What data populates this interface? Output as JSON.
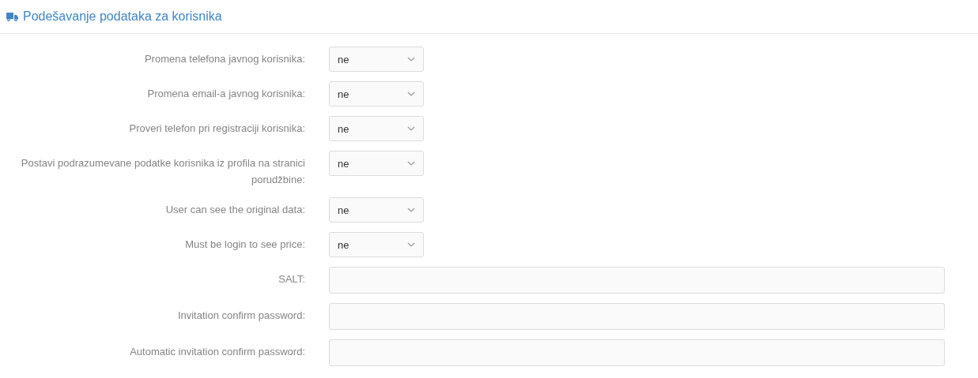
{
  "header": {
    "title": "Podešavanje podataka za korisnika"
  },
  "fields": [
    {
      "label": "Promena telefona javnog korisnika:",
      "kind": "select",
      "value": "ne"
    },
    {
      "label": "Promena email-a javnog korisnika:",
      "kind": "select",
      "value": "ne"
    },
    {
      "label": "Proveri telefon pri registraciji korisnika:",
      "kind": "select",
      "value": "ne"
    },
    {
      "label": "Postavi podrazumevane podatke korisnika iz profila na stranici porudžbine:",
      "kind": "select",
      "value": "ne"
    },
    {
      "label": "User can see the original data:",
      "kind": "select",
      "value": "ne"
    },
    {
      "label": "Must be login to see price:",
      "kind": "select",
      "value": "ne"
    },
    {
      "label": "SALT:",
      "kind": "text"
    },
    {
      "label": "Invitation confirm password:",
      "kind": "text"
    },
    {
      "label": "Automatic invitation confirm password:",
      "kind": "text"
    }
  ]
}
